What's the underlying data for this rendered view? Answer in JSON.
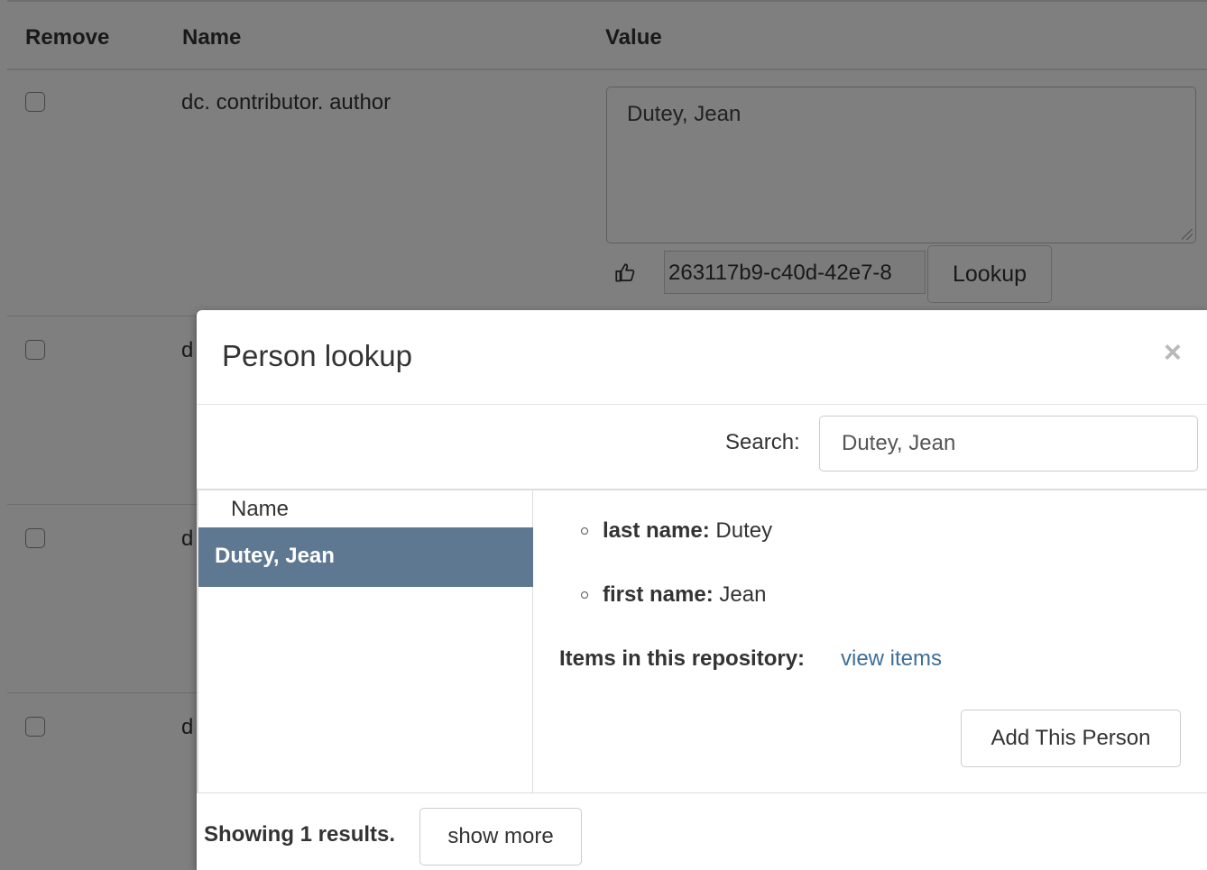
{
  "table": {
    "headers": {
      "remove": "Remove",
      "name": "Name",
      "value": "Value"
    },
    "rows": [
      {
        "field": "dc. contributor. author",
        "value": "Dutey, Jean",
        "authority_id": "263117b9-c40d-42e7-8",
        "lookup_label": "Lookup"
      },
      {
        "field": "d"
      },
      {
        "field": "d"
      },
      {
        "field": "d"
      }
    ]
  },
  "modal": {
    "title": "Person lookup",
    "close_symbol": "×",
    "search": {
      "label": "Search:",
      "value": "Dutey, Jean"
    },
    "results": {
      "column_header": "Name",
      "items": [
        {
          "name": "Dutey, Jean",
          "selected": true
        }
      ]
    },
    "details": {
      "last_name_label": "last name:",
      "last_name_value": "Dutey",
      "first_name_label": "first name:",
      "first_name_value": "Jean",
      "items_label": "Items in this repository:",
      "items_link": "view items",
      "add_button": "Add This Person"
    },
    "footer": {
      "results_count": "Showing 1 results.",
      "show_more": "show more"
    }
  },
  "colors": {
    "selected_row": "#5e7891",
    "link": "#3d6e9a",
    "backdrop": "rgba(0,0,0,0.5)"
  }
}
